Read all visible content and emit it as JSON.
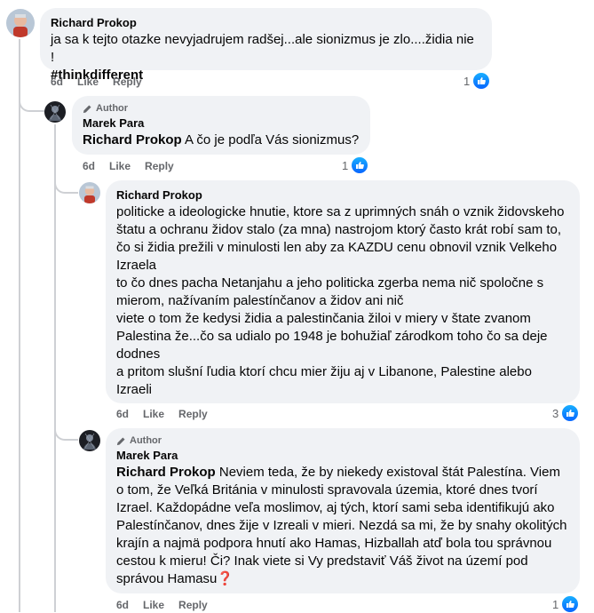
{
  "comments": [
    {
      "author": "Richard Prokop",
      "text": "ja sa k tejto otazke nevyjadrujem radšej...ale sionizmus je zlo....židia nie !",
      "hashtag": "#thinkdifferent",
      "time": "6d",
      "like_label": "Like",
      "reply_label": "Reply",
      "reactions": "1"
    },
    {
      "badge": "Author",
      "author": "Marek Para",
      "mention": "Richard Prokop",
      "text": " A čo je podľa Vás sionizmus?",
      "time": "6d",
      "like_label": "Like",
      "reply_label": "Reply",
      "reactions": "1"
    },
    {
      "author": "Richard Prokop",
      "text": "politicke a ideologicke hnutie, ktore sa z uprimných snáh o vznik židovskeho štatu a ochranu židov stalo (za mna) nastrojom ktorý často krát robí sam to, čo si židia prežili v minulosti len aby za KAZDU cenu obnovil vznik Velkeho Izraela\nto čo dnes pacha Netanjahu a jeho politicka zgerba nema nič spoločne s mierom, nažívaním palestínčanov a židov ani nič\nviete o tom že kedysi židia a palestinčania žiloi v miery v štate zvanom Palestina že...čo sa udialo po 1948 je bohužiaľ zárodkom toho čo sa deje dodnes\na pritom slušní ľudia ktorí chcu mier žiju aj v Libanone, Palestine alebo Izraeli",
      "time": "6d",
      "like_label": "Like",
      "reply_label": "Reply",
      "reactions": "3"
    },
    {
      "badge": "Author",
      "author": "Marek Para",
      "mention": "Richard Prokop",
      "text": " Neviem teda, že by niekedy existoval štát Palestína. Viem o tom, že Veľká Británia v minulosti spravovala územia, ktoré dnes tvorí Izrael. Každopádne veľa moslimov, aj tých, ktorí sami seba identifikujú ako Palestínčanov, dnes žije v Izreali v mieri. Nezdá sa mi, že by snahy okolitých krajín a najmä podpora hnutí ako Hamas, Hizballah atď bola tou správnou cestou k mieru! Či? Inak viete si Vy predstaviť Váš život na území pod správou Hamasu",
      "emoji": "❓",
      "time": "6d",
      "like_label": "Like",
      "reply_label": "Reply",
      "reactions": "1"
    }
  ],
  "colors": {
    "like_blue": "#0866ff",
    "bubble": "#f0f2f5",
    "meta": "#65676b"
  }
}
